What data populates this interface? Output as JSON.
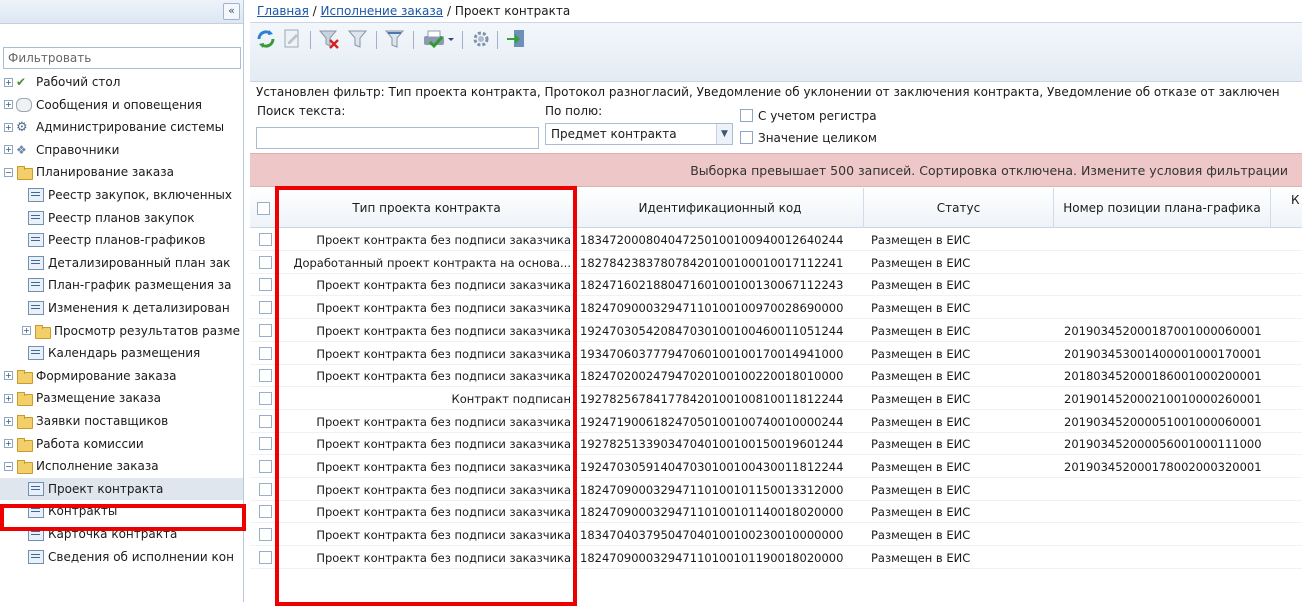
{
  "sidebar": {
    "collapse_label": "«",
    "filter_placeholder": "Фильтровать",
    "items": [
      {
        "label": "Рабочий стол",
        "icon": "desktop-icon",
        "expander": "+"
      },
      {
        "label": "Сообщения и оповещения",
        "icon": "messages-icon",
        "expander": "+"
      },
      {
        "label": "Администрирование системы",
        "icon": "admin-icon",
        "expander": "+"
      },
      {
        "label": "Справочники",
        "icon": "reference-icon",
        "expander": "+"
      },
      {
        "label": "Планирование заказа",
        "icon": "folder-icon",
        "expander": "−"
      },
      {
        "label": "Реестр закупок, включенных",
        "icon": "document-icon"
      },
      {
        "label": "Реестр планов закупок",
        "icon": "document-icon"
      },
      {
        "label": "Реестр планов-графиков",
        "icon": "document-icon"
      },
      {
        "label": "Детализированный план зак",
        "icon": "document-icon"
      },
      {
        "label": "План-график размещения за",
        "icon": "document-icon"
      },
      {
        "label": "Изменения к детализирован",
        "icon": "document-icon"
      },
      {
        "label": "Просмотр результатов разме",
        "icon": "folder-icon",
        "expander": "+"
      },
      {
        "label": "Календарь размещения",
        "icon": "document-icon"
      },
      {
        "label": "Формирование заказа",
        "icon": "folder-icon",
        "expander": "+"
      },
      {
        "label": "Размещение заказа",
        "icon": "folder-icon",
        "expander": "+"
      },
      {
        "label": "Заявки поставщиков",
        "icon": "folder-icon",
        "expander": "+"
      },
      {
        "label": "Работа комиссии",
        "icon": "folder-icon",
        "expander": "+"
      },
      {
        "label": "Исполнение заказа",
        "icon": "folder-icon",
        "expander": "−"
      },
      {
        "label": "Проект контракта",
        "icon": "document-icon"
      },
      {
        "label": "Контракты",
        "icon": "document-icon"
      },
      {
        "label": "Карточка контракта",
        "icon": "document-icon"
      },
      {
        "label": "Сведения об исполнении кон",
        "icon": "document-icon"
      }
    ]
  },
  "breadcrumb": {
    "home": "Главная",
    "section": "Исполнение заказа",
    "current": "Проект контракта",
    "separator": "/"
  },
  "filter": {
    "status_text": "Установлен фильтр: Тип проекта контракта, Протокол разногласий, Уведомление об уклонении от заключения контракта, Уведомление об отказе от заключен",
    "search_label": "Поиск текста:",
    "search_value": "",
    "field_label": "По полю:",
    "field_value": "Предмет контракта",
    "case_label": "С учетом регистра",
    "whole_label": "Значение целиком"
  },
  "warning": "Выборка превышает 500 записей. Сортировка отключена. Измените условия фильтрации",
  "grid": {
    "columns": [
      "Тип проекта контракта",
      "Идентификационный код",
      "Статус",
      "Номер позиции плана-графика",
      "К"
    ],
    "rows": [
      [
        "Проект контракта без подписи заказчика",
        "183472000804047250100100940012640244",
        "Размещен в ЕИС",
        ""
      ],
      [
        "Доработанный проект контракта на основа...",
        "182784238378078420100100010017112241",
        "Размещен в ЕИС",
        ""
      ],
      [
        "Проект контракта без подписи заказчика",
        "182471602188047160100100130067112243",
        "Размещен в ЕИС",
        ""
      ],
      [
        "Проект контракта без подписи заказчика",
        "182470900032947110100100970028690000",
        "Размещен в ЕИС",
        ""
      ],
      [
        "Проект контракта без подписи заказчика",
        "192470305420847030100100460011051244",
        "Размещен в ЕИС",
        "201903452000187001000060001"
      ],
      [
        "Проект контракта без подписи заказчика",
        "193470603777947060100100170014941000",
        "Размещен в ЕИС",
        "201903453001400001000170001"
      ],
      [
        "Проект контракта без подписи заказчика",
        "182470200247947020100100220018010000",
        "Размещен в ЕИС",
        "201803452000186001000200001"
      ],
      [
        "Контракт подписан",
        "192782567841778420100100810011812244",
        "Размещен в ЕИС",
        "201901452000210010000260001"
      ],
      [
        "Проект контракта без подписи заказчика",
        "192471900618247050100100740010000244",
        "Размещен в ЕИС",
        "201903452000051001000060001"
      ],
      [
        "Проект контракта без подписи заказчика",
        "192782513390347040100100150019601244",
        "Размещен в ЕИС",
        "201903452000056001000111000"
      ],
      [
        "Проект контракта без подписи заказчика",
        "192470305914047030100100430011812244",
        "Размещен в ЕИС",
        "201903452000178002000320001"
      ],
      [
        "Проект контракта без подписи заказчика",
        "182470900032947110100101150013312000",
        "Размещен в ЕИС",
        ""
      ],
      [
        "Проект контракта без подписи заказчика",
        "182470900032947110100101140018020000",
        "Размещен в ЕИС",
        ""
      ],
      [
        "Проект контракта без подписи заказчика",
        "183470403795047040100100230010000000",
        "Размещен в ЕИС",
        ""
      ],
      [
        "Проект контракта без подписи заказчика",
        "182470900032947110100101190018020000",
        "Размещен в ЕИС",
        ""
      ]
    ]
  },
  "colors": {
    "highlight": "#ee0000",
    "warning_bg": "#eec8c8",
    "link": "#1a56a8"
  }
}
